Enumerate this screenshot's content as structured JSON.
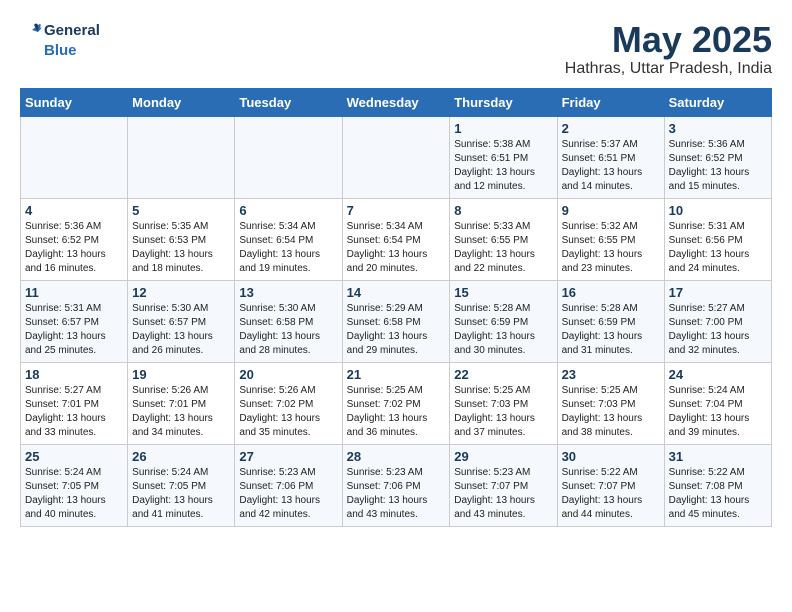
{
  "logo": {
    "line1": "General",
    "line2": "Blue"
  },
  "title": "May 2025",
  "subtitle": "Hathras, Uttar Pradesh, India",
  "weekdays": [
    "Sunday",
    "Monday",
    "Tuesday",
    "Wednesday",
    "Thursday",
    "Friday",
    "Saturday"
  ],
  "weeks": [
    [
      {
        "day": "",
        "info": ""
      },
      {
        "day": "",
        "info": ""
      },
      {
        "day": "",
        "info": ""
      },
      {
        "day": "",
        "info": ""
      },
      {
        "day": "1",
        "info": "Sunrise: 5:38 AM\nSunset: 6:51 PM\nDaylight: 13 hours\nand 12 minutes."
      },
      {
        "day": "2",
        "info": "Sunrise: 5:37 AM\nSunset: 6:51 PM\nDaylight: 13 hours\nand 14 minutes."
      },
      {
        "day": "3",
        "info": "Sunrise: 5:36 AM\nSunset: 6:52 PM\nDaylight: 13 hours\nand 15 minutes."
      }
    ],
    [
      {
        "day": "4",
        "info": "Sunrise: 5:36 AM\nSunset: 6:52 PM\nDaylight: 13 hours\nand 16 minutes."
      },
      {
        "day": "5",
        "info": "Sunrise: 5:35 AM\nSunset: 6:53 PM\nDaylight: 13 hours\nand 18 minutes."
      },
      {
        "day": "6",
        "info": "Sunrise: 5:34 AM\nSunset: 6:54 PM\nDaylight: 13 hours\nand 19 minutes."
      },
      {
        "day": "7",
        "info": "Sunrise: 5:34 AM\nSunset: 6:54 PM\nDaylight: 13 hours\nand 20 minutes."
      },
      {
        "day": "8",
        "info": "Sunrise: 5:33 AM\nSunset: 6:55 PM\nDaylight: 13 hours\nand 22 minutes."
      },
      {
        "day": "9",
        "info": "Sunrise: 5:32 AM\nSunset: 6:55 PM\nDaylight: 13 hours\nand 23 minutes."
      },
      {
        "day": "10",
        "info": "Sunrise: 5:31 AM\nSunset: 6:56 PM\nDaylight: 13 hours\nand 24 minutes."
      }
    ],
    [
      {
        "day": "11",
        "info": "Sunrise: 5:31 AM\nSunset: 6:57 PM\nDaylight: 13 hours\nand 25 minutes."
      },
      {
        "day": "12",
        "info": "Sunrise: 5:30 AM\nSunset: 6:57 PM\nDaylight: 13 hours\nand 26 minutes."
      },
      {
        "day": "13",
        "info": "Sunrise: 5:30 AM\nSunset: 6:58 PM\nDaylight: 13 hours\nand 28 minutes."
      },
      {
        "day": "14",
        "info": "Sunrise: 5:29 AM\nSunset: 6:58 PM\nDaylight: 13 hours\nand 29 minutes."
      },
      {
        "day": "15",
        "info": "Sunrise: 5:28 AM\nSunset: 6:59 PM\nDaylight: 13 hours\nand 30 minutes."
      },
      {
        "day": "16",
        "info": "Sunrise: 5:28 AM\nSunset: 6:59 PM\nDaylight: 13 hours\nand 31 minutes."
      },
      {
        "day": "17",
        "info": "Sunrise: 5:27 AM\nSunset: 7:00 PM\nDaylight: 13 hours\nand 32 minutes."
      }
    ],
    [
      {
        "day": "18",
        "info": "Sunrise: 5:27 AM\nSunset: 7:01 PM\nDaylight: 13 hours\nand 33 minutes."
      },
      {
        "day": "19",
        "info": "Sunrise: 5:26 AM\nSunset: 7:01 PM\nDaylight: 13 hours\nand 34 minutes."
      },
      {
        "day": "20",
        "info": "Sunrise: 5:26 AM\nSunset: 7:02 PM\nDaylight: 13 hours\nand 35 minutes."
      },
      {
        "day": "21",
        "info": "Sunrise: 5:25 AM\nSunset: 7:02 PM\nDaylight: 13 hours\nand 36 minutes."
      },
      {
        "day": "22",
        "info": "Sunrise: 5:25 AM\nSunset: 7:03 PM\nDaylight: 13 hours\nand 37 minutes."
      },
      {
        "day": "23",
        "info": "Sunrise: 5:25 AM\nSunset: 7:03 PM\nDaylight: 13 hours\nand 38 minutes."
      },
      {
        "day": "24",
        "info": "Sunrise: 5:24 AM\nSunset: 7:04 PM\nDaylight: 13 hours\nand 39 minutes."
      }
    ],
    [
      {
        "day": "25",
        "info": "Sunrise: 5:24 AM\nSunset: 7:05 PM\nDaylight: 13 hours\nand 40 minutes."
      },
      {
        "day": "26",
        "info": "Sunrise: 5:24 AM\nSunset: 7:05 PM\nDaylight: 13 hours\nand 41 minutes."
      },
      {
        "day": "27",
        "info": "Sunrise: 5:23 AM\nSunset: 7:06 PM\nDaylight: 13 hours\nand 42 minutes."
      },
      {
        "day": "28",
        "info": "Sunrise: 5:23 AM\nSunset: 7:06 PM\nDaylight: 13 hours\nand 43 minutes."
      },
      {
        "day": "29",
        "info": "Sunrise: 5:23 AM\nSunset: 7:07 PM\nDaylight: 13 hours\nand 43 minutes."
      },
      {
        "day": "30",
        "info": "Sunrise: 5:22 AM\nSunset: 7:07 PM\nDaylight: 13 hours\nand 44 minutes."
      },
      {
        "day": "31",
        "info": "Sunrise: 5:22 AM\nSunset: 7:08 PM\nDaylight: 13 hours\nand 45 minutes."
      }
    ]
  ]
}
